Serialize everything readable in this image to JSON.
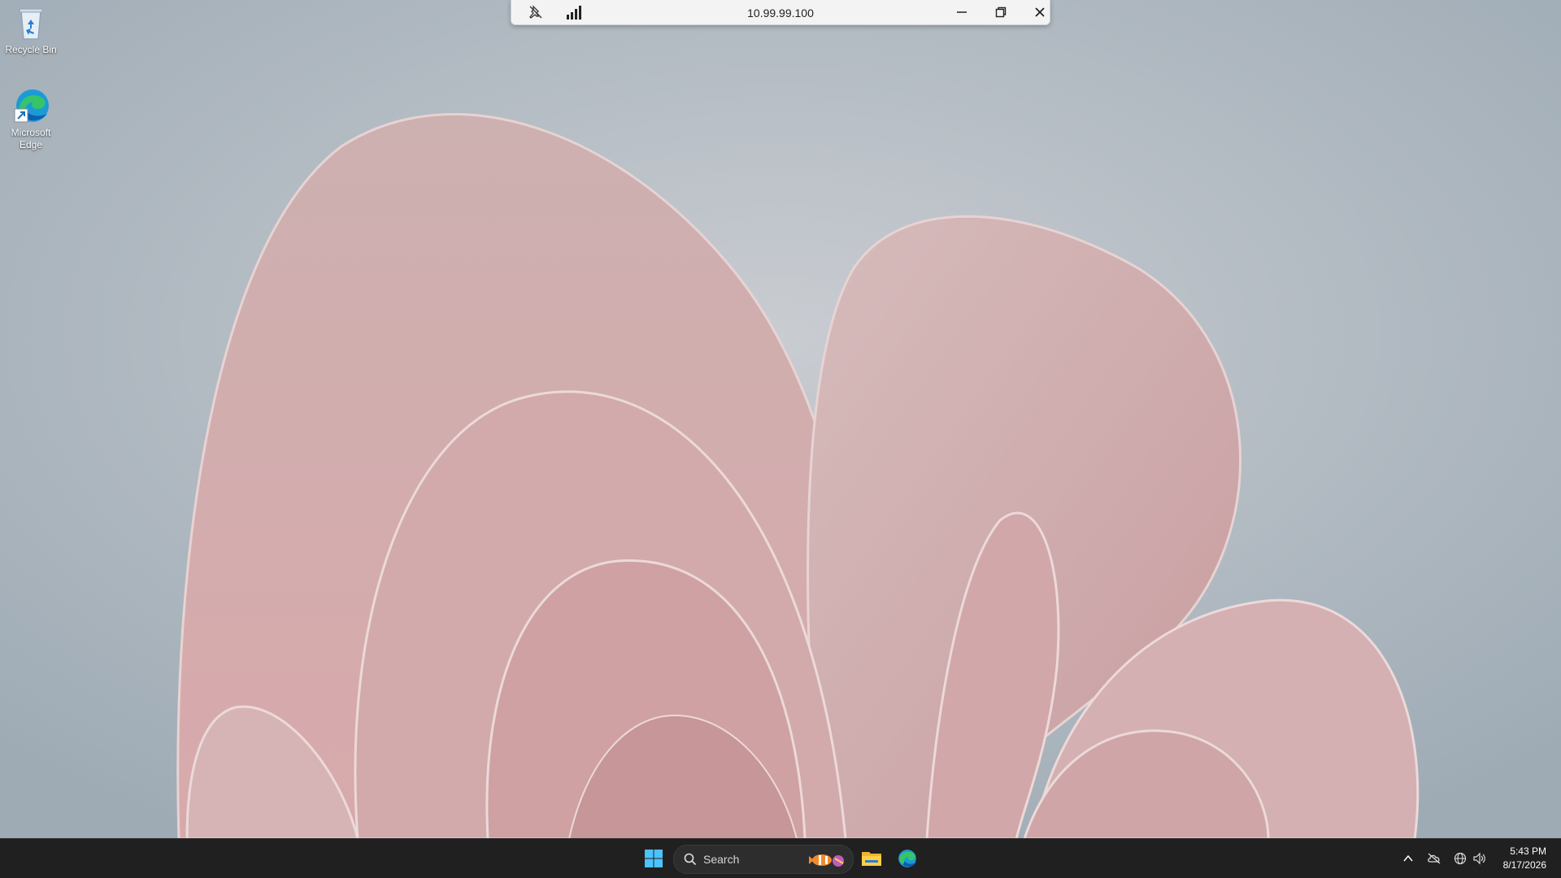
{
  "desktop": {
    "icons": [
      {
        "label": "Recycle Bin",
        "icon": "recycle-bin-icon"
      },
      {
        "label": "Microsoft Edge",
        "icon": "edge-icon"
      }
    ]
  },
  "rdp_bar": {
    "title": "10.99.99.100",
    "pin_icon": "unpin-icon",
    "signal_icon": "connection-quality-icon",
    "minimize_icon": "minimize-icon",
    "restore_icon": "restore-icon",
    "close_icon": "close-icon"
  },
  "taskbar": {
    "search_placeholder": "Search",
    "start_icon": "windows-start-icon",
    "pinned": [
      "file-explorer-icon",
      "edge-icon"
    ],
    "tray": {
      "overflow_icon": "chevron-up-icon",
      "onedrive_icon": "cloud-offline-icon",
      "network_icon": "globe-icon",
      "volume_icon": "speaker-icon"
    },
    "time": "5:43 PM",
    "date": "8/17/2026"
  },
  "colors": {
    "taskbar_bg": "#202020",
    "accent_blue": "#0a84e8",
    "petal_pink": "#d9b4b7"
  }
}
